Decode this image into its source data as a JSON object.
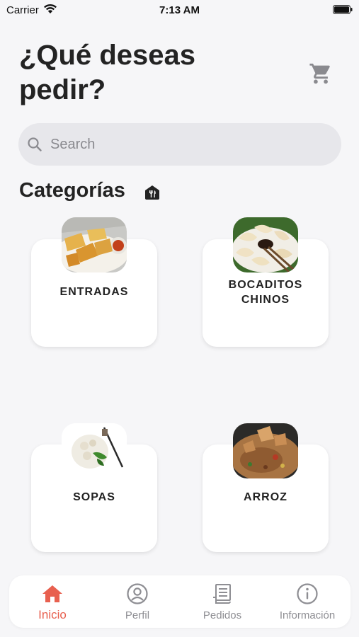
{
  "status_bar": {
    "carrier": "Carrier",
    "time": "7:13 AM"
  },
  "header": {
    "title": "¿Qué deseas pedir?",
    "cart_icon": "cart-icon"
  },
  "search": {
    "placeholder": "Search",
    "value": ""
  },
  "section": {
    "title": "Categorías",
    "icon": "restaurant-icon"
  },
  "categories": [
    {
      "label": "ENTRADAS",
      "image": "fried-tofu-image"
    },
    {
      "label": "BOCADITOS CHINOS",
      "image": "dumplings-image"
    },
    {
      "label": "SOPAS",
      "image": "soup-image"
    },
    {
      "label": "ARROZ",
      "image": "fried-rice-image"
    }
  ],
  "tab_bar": {
    "active_color": "#E8604F",
    "inactive_color": "#8E8E93",
    "items": [
      {
        "label": "Inicio",
        "icon": "home-icon",
        "active": true
      },
      {
        "label": "Perfil",
        "icon": "profile-icon",
        "active": false
      },
      {
        "label": "Pedidos",
        "icon": "receipt-icon",
        "active": false
      },
      {
        "label": "Información",
        "icon": "info-icon",
        "active": false
      }
    ]
  },
  "colors": {
    "background": "#F6F6F8",
    "search_bg": "#E7E7EB",
    "accent": "#E8604F"
  }
}
